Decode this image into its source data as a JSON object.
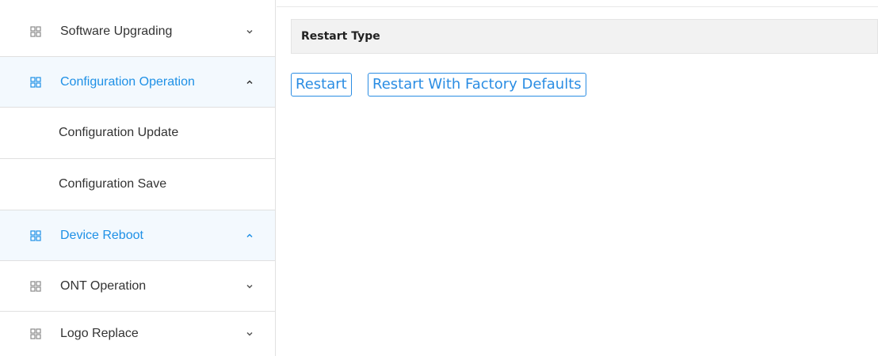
{
  "sidebar": {
    "items": [
      {
        "label": "Software Upgrading",
        "icon": "grid-icon",
        "chevron": "chevron-down-icon",
        "active": false
      },
      {
        "label": "Configuration Operation",
        "icon": "grid-icon",
        "chevron": "chevron-up-icon",
        "active": true
      },
      {
        "label": "Configuration Update"
      },
      {
        "label": "Configuration Save"
      },
      {
        "label": "Device Reboot",
        "icon": "grid-icon",
        "chevron": "chevron-up-icon",
        "active": true
      },
      {
        "label": "ONT Operation",
        "icon": "grid-icon",
        "chevron": "chevron-down-icon",
        "active": false
      },
      {
        "label": "Logo Replace",
        "icon": "grid-icon",
        "chevron": "chevron-down-icon",
        "active": false
      }
    ]
  },
  "main": {
    "header": "Restart Type",
    "buttons": {
      "restart": "Restart",
      "factory": "Restart With Factory Defaults"
    }
  },
  "colors": {
    "accent": "#1e90e6",
    "active_bg": "#f3f9fe",
    "text": "#333333"
  }
}
